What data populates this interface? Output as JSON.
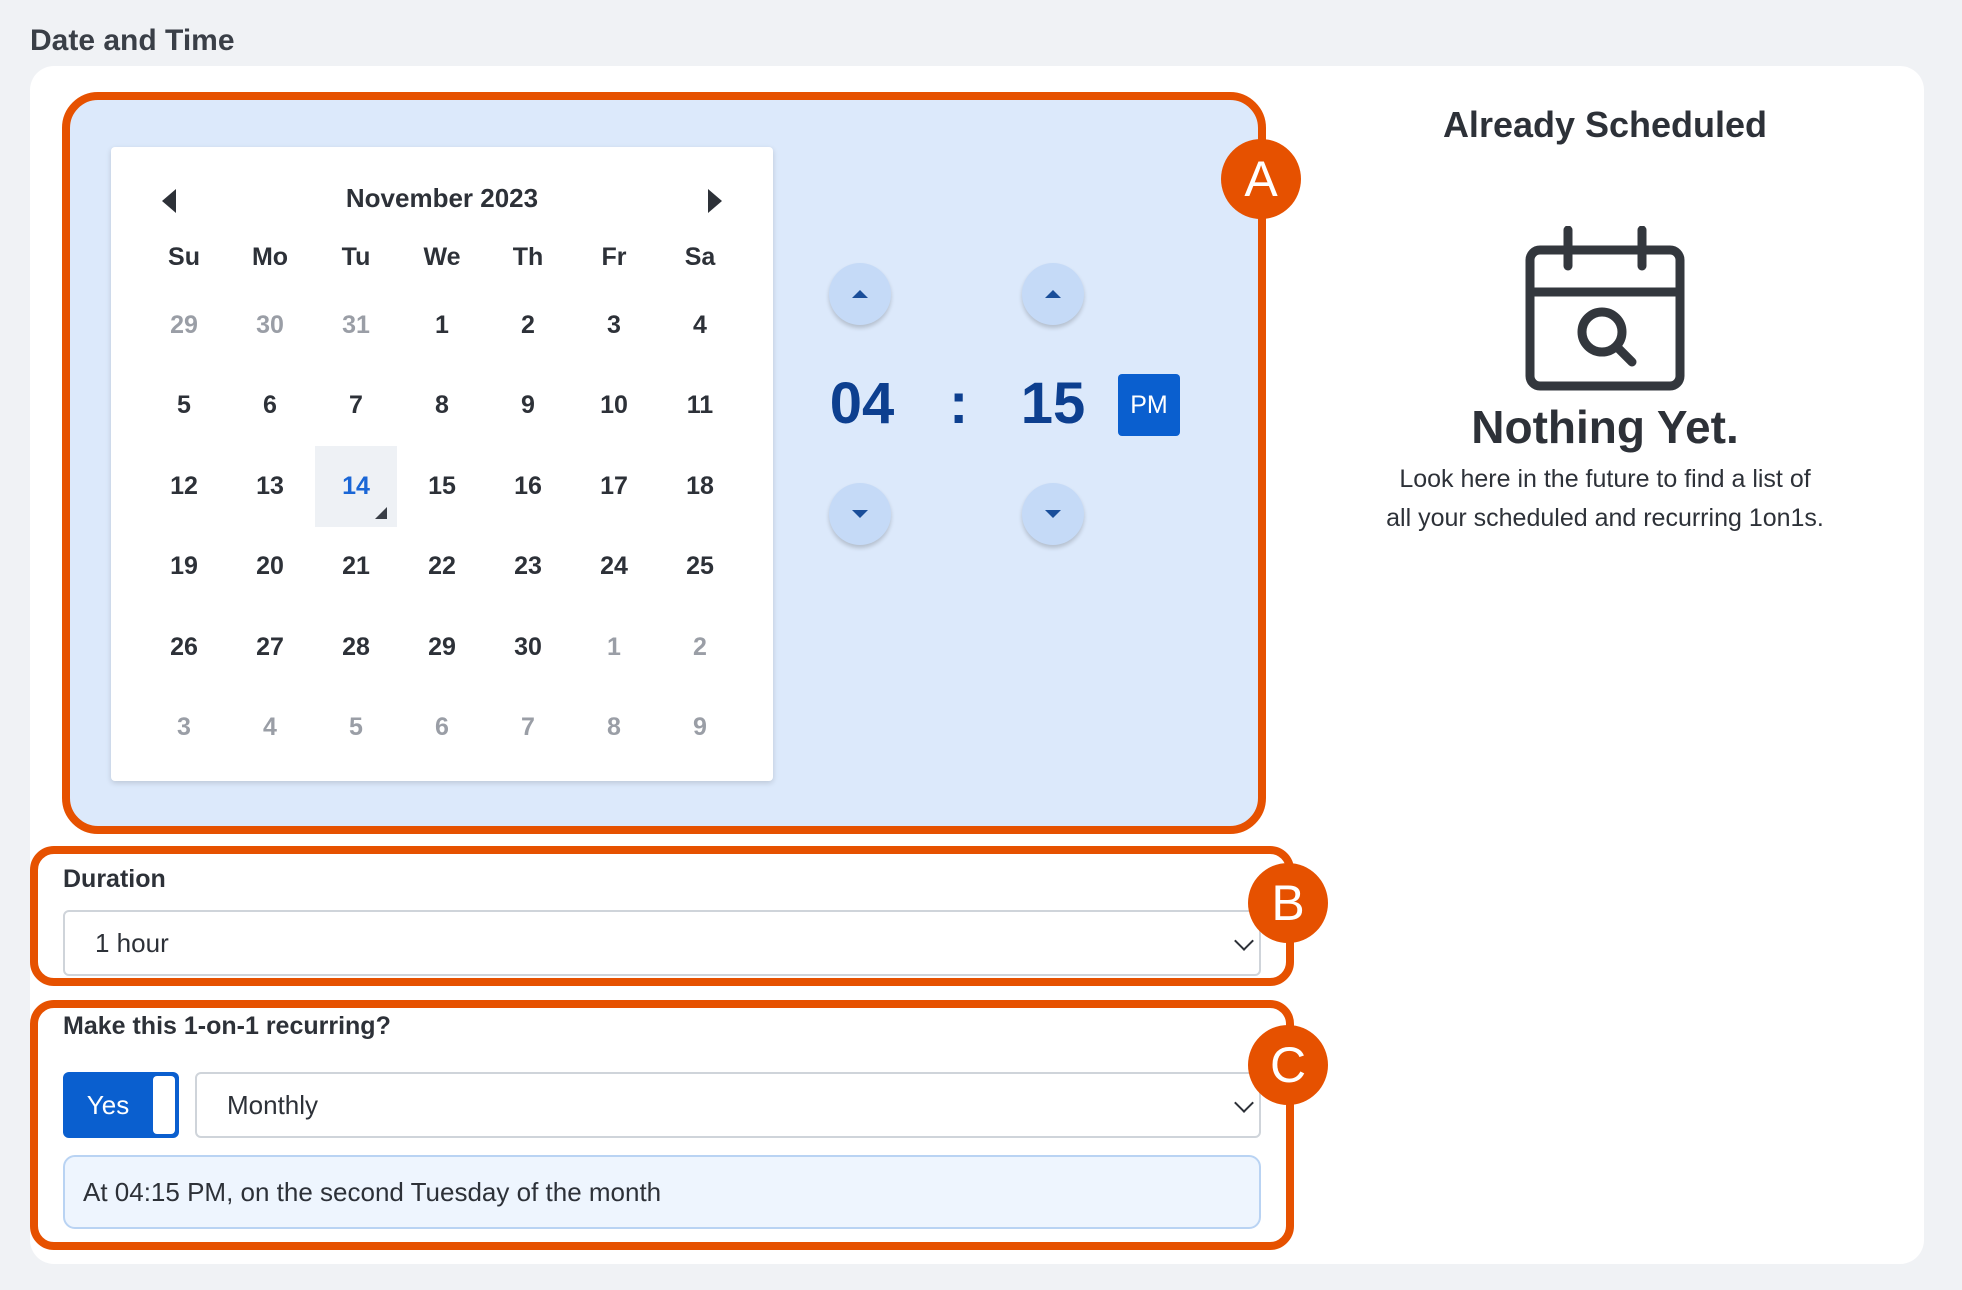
{
  "section": {
    "title": "Date and Time"
  },
  "calendar": {
    "month_label": "November 2023",
    "weekdays": [
      "Su",
      "Mo",
      "Tu",
      "We",
      "Th",
      "Fr",
      "Sa"
    ],
    "days": [
      {
        "label": "29",
        "muted": true
      },
      {
        "label": "30",
        "muted": true
      },
      {
        "label": "31",
        "muted": true
      },
      {
        "label": "1"
      },
      {
        "label": "2"
      },
      {
        "label": "3"
      },
      {
        "label": "4"
      },
      {
        "label": "5"
      },
      {
        "label": "6"
      },
      {
        "label": "7"
      },
      {
        "label": "8"
      },
      {
        "label": "9"
      },
      {
        "label": "10"
      },
      {
        "label": "11"
      },
      {
        "label": "12"
      },
      {
        "label": "13"
      },
      {
        "label": "14",
        "selected": true
      },
      {
        "label": "15"
      },
      {
        "label": "16"
      },
      {
        "label": "17"
      },
      {
        "label": "18"
      },
      {
        "label": "19"
      },
      {
        "label": "20"
      },
      {
        "label": "21"
      },
      {
        "label": "22"
      },
      {
        "label": "23"
      },
      {
        "label": "24"
      },
      {
        "label": "25"
      },
      {
        "label": "26"
      },
      {
        "label": "27"
      },
      {
        "label": "28"
      },
      {
        "label": "29"
      },
      {
        "label": "30"
      },
      {
        "label": "1",
        "muted": true
      },
      {
        "label": "2",
        "muted": true
      },
      {
        "label": "3",
        "muted": true
      },
      {
        "label": "4",
        "muted": true
      },
      {
        "label": "5",
        "muted": true
      },
      {
        "label": "6",
        "muted": true
      },
      {
        "label": "7",
        "muted": true
      },
      {
        "label": "8",
        "muted": true
      },
      {
        "label": "9",
        "muted": true
      }
    ]
  },
  "time": {
    "hour": "04",
    "separator": ":",
    "minute": "15",
    "period": "PM"
  },
  "badges": {
    "a": "A",
    "b": "B",
    "c": "C"
  },
  "duration": {
    "label": "Duration",
    "value": "1 hour"
  },
  "recurring": {
    "label": "Make this 1-on-1 recurring?",
    "toggle_label": "Yes",
    "frequency": "Monthly",
    "summary": "At 04:15 PM, on the second Tuesday of the month"
  },
  "scheduled": {
    "title": "Already Scheduled",
    "empty_title": "Nothing Yet.",
    "empty_line1": "Look here in the future to find a list of",
    "empty_line2": "all your scheduled and recurring 1on1s."
  },
  "colors": {
    "highlight": "#e65100",
    "primary": "#0a5fcf",
    "panel": "#dce9fb",
    "time_text": "#0d3f8f"
  },
  "icons": {
    "prev": "triangle-left-icon",
    "next": "triangle-right-icon",
    "increment": "caret-up-icon",
    "decrement": "caret-down-icon",
    "dropdown": "chevron-down-icon",
    "empty_state": "calendar-search-icon"
  }
}
